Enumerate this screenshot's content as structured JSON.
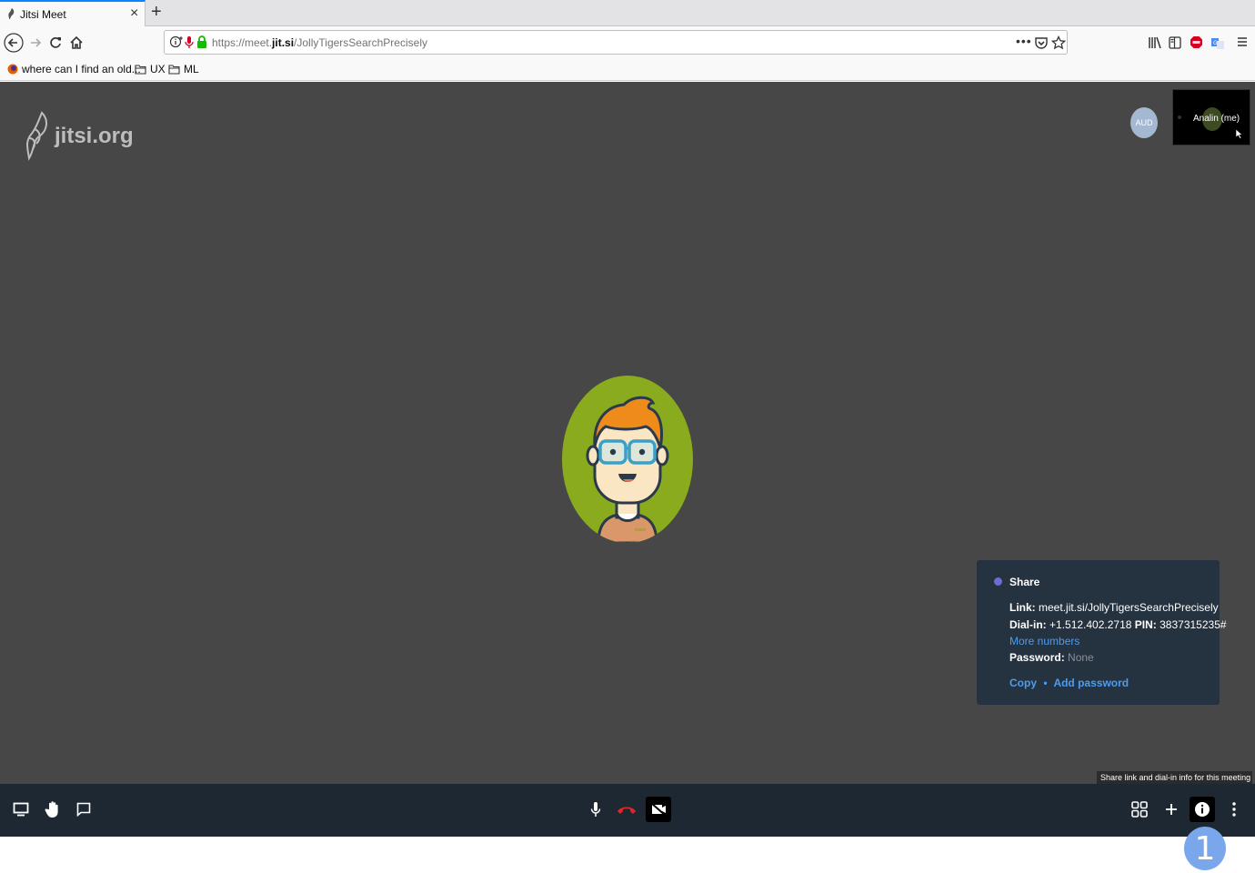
{
  "browser": {
    "tab_title": "Jitsi Meet",
    "tab_close": "×",
    "new_tab": "+",
    "url_prefix": "https://meet.",
    "url_domain": "jit.si",
    "url_path": "/JollyTigersSearchPrecisely",
    "url_more": "•••",
    "bookmarks": [
      {
        "label": "where can I find an old..."
      },
      {
        "label": "UX"
      },
      {
        "label": "ML"
      }
    ]
  },
  "stage": {
    "logo_text": "jitsi.org",
    "audio_badge": "AUD",
    "self_name": "Analin (me)"
  },
  "share_panel": {
    "title": "Share",
    "link_label": "Link:",
    "link_value": "meet.jit.si/JollyTigersSearchPrecisely",
    "dialin_label": "Dial-in:",
    "dialin_value": "+1.512.402.2718",
    "pin_label": "PIN:",
    "pin_value": "3837315235#",
    "more_numbers": "More numbers",
    "password_label": "Password:",
    "password_value": "None",
    "copy": "Copy",
    "separator": "•",
    "add_password": "Add password"
  },
  "tooltip": "Share link and dial-in info for this meeting",
  "annotation_badge": "1",
  "colors": {
    "stage_bg": "#474747",
    "toolbar_bg": "#1d2833",
    "panel_bg": "#253240",
    "link_blue": "#4d9cf0",
    "hangup_red": "#e32427",
    "avatar_green": "#8aab1e"
  }
}
